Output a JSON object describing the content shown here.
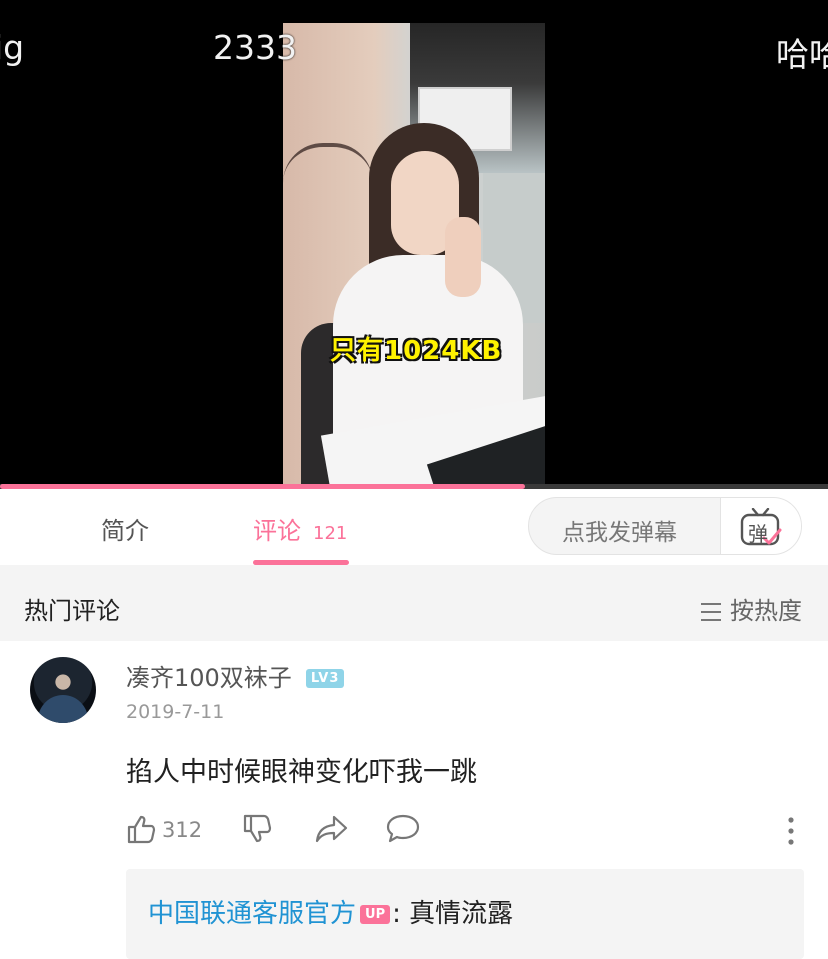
{
  "player": {
    "danmaku": [
      {
        "text": "ig"
      },
      {
        "text": "2333"
      },
      {
        "text": "哈哈"
      }
    ],
    "subtitle": "只有1024KB",
    "progress": 0.634
  },
  "tabs": {
    "intro_label": "简介",
    "comments_label": "评论",
    "comments_count": "121",
    "danmaku_placeholder": "点我发弹幕",
    "danmaku_icon_char": "弹"
  },
  "hot": {
    "title": "热门评论",
    "sort_label": "按热度"
  },
  "comment": {
    "username": "凑齐100双袜子",
    "level": "LV3",
    "date": "2019-7-11",
    "text": "掐人中时候眼神变化吓我一跳",
    "likes": "312",
    "reply": {
      "user": "中国联通客服官方",
      "badge": "UP",
      "separator": ": ",
      "text": "真情流露"
    }
  },
  "colors": {
    "accent": "#fb7299",
    "link": "#2093d3",
    "level_badge": "#8fd4e8"
  }
}
